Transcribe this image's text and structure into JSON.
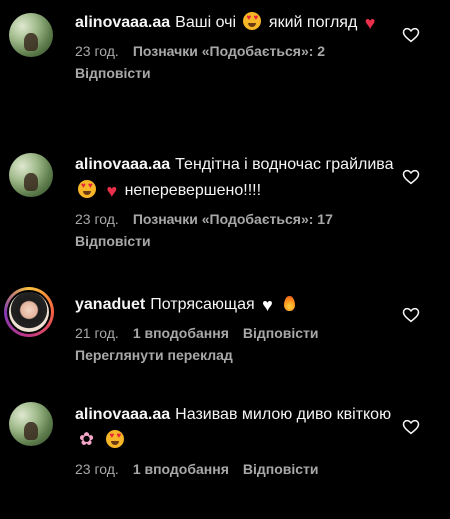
{
  "comments": [
    {
      "username": "alinovaaa.aa",
      "text_a": "Ваші очі",
      "text_b": "який погляд",
      "time": "23 год.",
      "likes": "Позначки «Подобається»: 2",
      "reply": "Відповісти",
      "avatar": "user-avatar-photo"
    },
    {
      "username": "alinovaaa.aa",
      "text_a": "Тендітна і водночас грайлива",
      "text_b": "неперевершено!!!!",
      "time": "23 год.",
      "likes": "Позначки «Подобається»: 17",
      "reply": "Відповісти",
      "avatar": "user-avatar-photo"
    },
    {
      "username": "yanaduet",
      "text_a": "Потрясающая",
      "time": "21 год.",
      "likes": "1 вподобання",
      "reply": "Відповісти",
      "translate": "Переглянути переклад",
      "avatar": "story-avatar"
    },
    {
      "username": "alinovaaa.aa",
      "text_a": "Називав милою диво квіткою",
      "time": "23 год.",
      "likes": "1 вподобання",
      "reply": "Відповісти",
      "avatar": "user-avatar-photo"
    }
  ],
  "icons": {
    "like": "heart-outline-icon",
    "emoji_love": "smiling-face-with-heart-eyes",
    "emoji_red_heart": "red-heart",
    "emoji_white_heart": "white-heart",
    "emoji_fire": "fire",
    "emoji_blossom": "cherry-blossom"
  },
  "colors": {
    "background": "#000000",
    "text": "#f5f5f5",
    "muted": "#a8a8a8",
    "red_heart": "#ec2f4b"
  }
}
